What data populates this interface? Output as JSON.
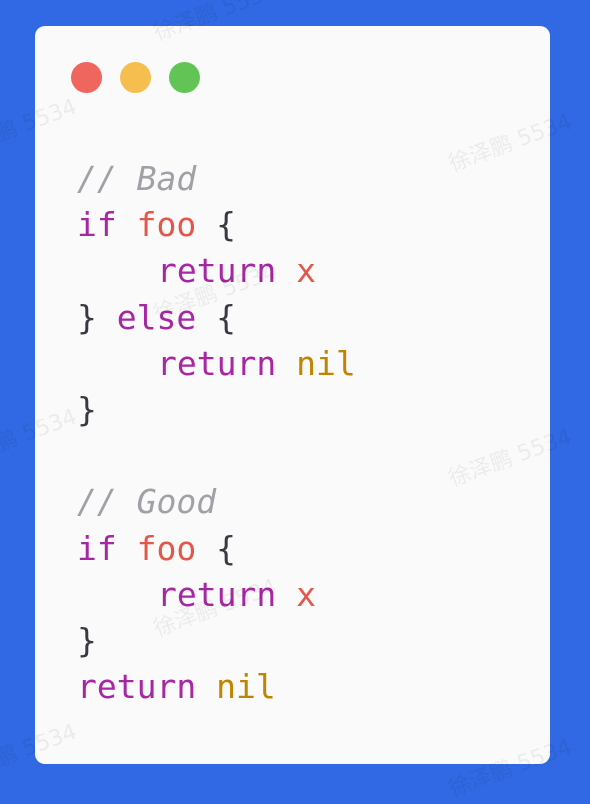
{
  "window": {
    "traffic_lights": [
      "close",
      "minimize",
      "zoom"
    ]
  },
  "code": {
    "lines": [
      {
        "tokens": [
          {
            "t": "cm",
            "v": "// Bad"
          }
        ]
      },
      {
        "tokens": [
          {
            "t": "kw",
            "v": "if"
          },
          {
            "t": "sp",
            "v": " "
          },
          {
            "t": "var",
            "v": "foo"
          },
          {
            "t": "sp",
            "v": " "
          },
          {
            "t": "pn",
            "v": "{"
          }
        ]
      },
      {
        "tokens": [
          {
            "t": "ind",
            "v": ""
          },
          {
            "t": "kw",
            "v": "return"
          },
          {
            "t": "sp",
            "v": " "
          },
          {
            "t": "var",
            "v": "x"
          }
        ]
      },
      {
        "tokens": [
          {
            "t": "pn",
            "v": "}"
          },
          {
            "t": "sp",
            "v": " "
          },
          {
            "t": "kw",
            "v": "else"
          },
          {
            "t": "sp",
            "v": " "
          },
          {
            "t": "pn",
            "v": "{"
          }
        ]
      },
      {
        "tokens": [
          {
            "t": "ind",
            "v": ""
          },
          {
            "t": "kw",
            "v": "return"
          },
          {
            "t": "sp",
            "v": " "
          },
          {
            "t": "nil",
            "v": "nil"
          }
        ]
      },
      {
        "tokens": [
          {
            "t": "pn",
            "v": "}"
          }
        ]
      },
      {
        "tokens": []
      },
      {
        "tokens": [
          {
            "t": "cm",
            "v": "// Good"
          }
        ]
      },
      {
        "tokens": [
          {
            "t": "kw",
            "v": "if"
          },
          {
            "t": "sp",
            "v": " "
          },
          {
            "t": "var",
            "v": "foo"
          },
          {
            "t": "sp",
            "v": " "
          },
          {
            "t": "pn",
            "v": "{"
          }
        ]
      },
      {
        "tokens": [
          {
            "t": "ind",
            "v": ""
          },
          {
            "t": "kw",
            "v": "return"
          },
          {
            "t": "sp",
            "v": " "
          },
          {
            "t": "var",
            "v": "x"
          }
        ]
      },
      {
        "tokens": [
          {
            "t": "pn",
            "v": "}"
          }
        ]
      },
      {
        "tokens": [
          {
            "t": "kw",
            "v": "return"
          },
          {
            "t": "sp",
            "v": " "
          },
          {
            "t": "nil",
            "v": "nil"
          }
        ]
      }
    ]
  },
  "watermark": "徐泽鹏 5534",
  "colors": {
    "background": "#3069e3",
    "window": "#fafafa",
    "close": "#ef665e",
    "minimize": "#f6be4f",
    "zoom": "#61c454",
    "keyword": "#a626a4",
    "variable": "#e45649",
    "nil": "#c18401",
    "comment": "#a0a1a7"
  }
}
